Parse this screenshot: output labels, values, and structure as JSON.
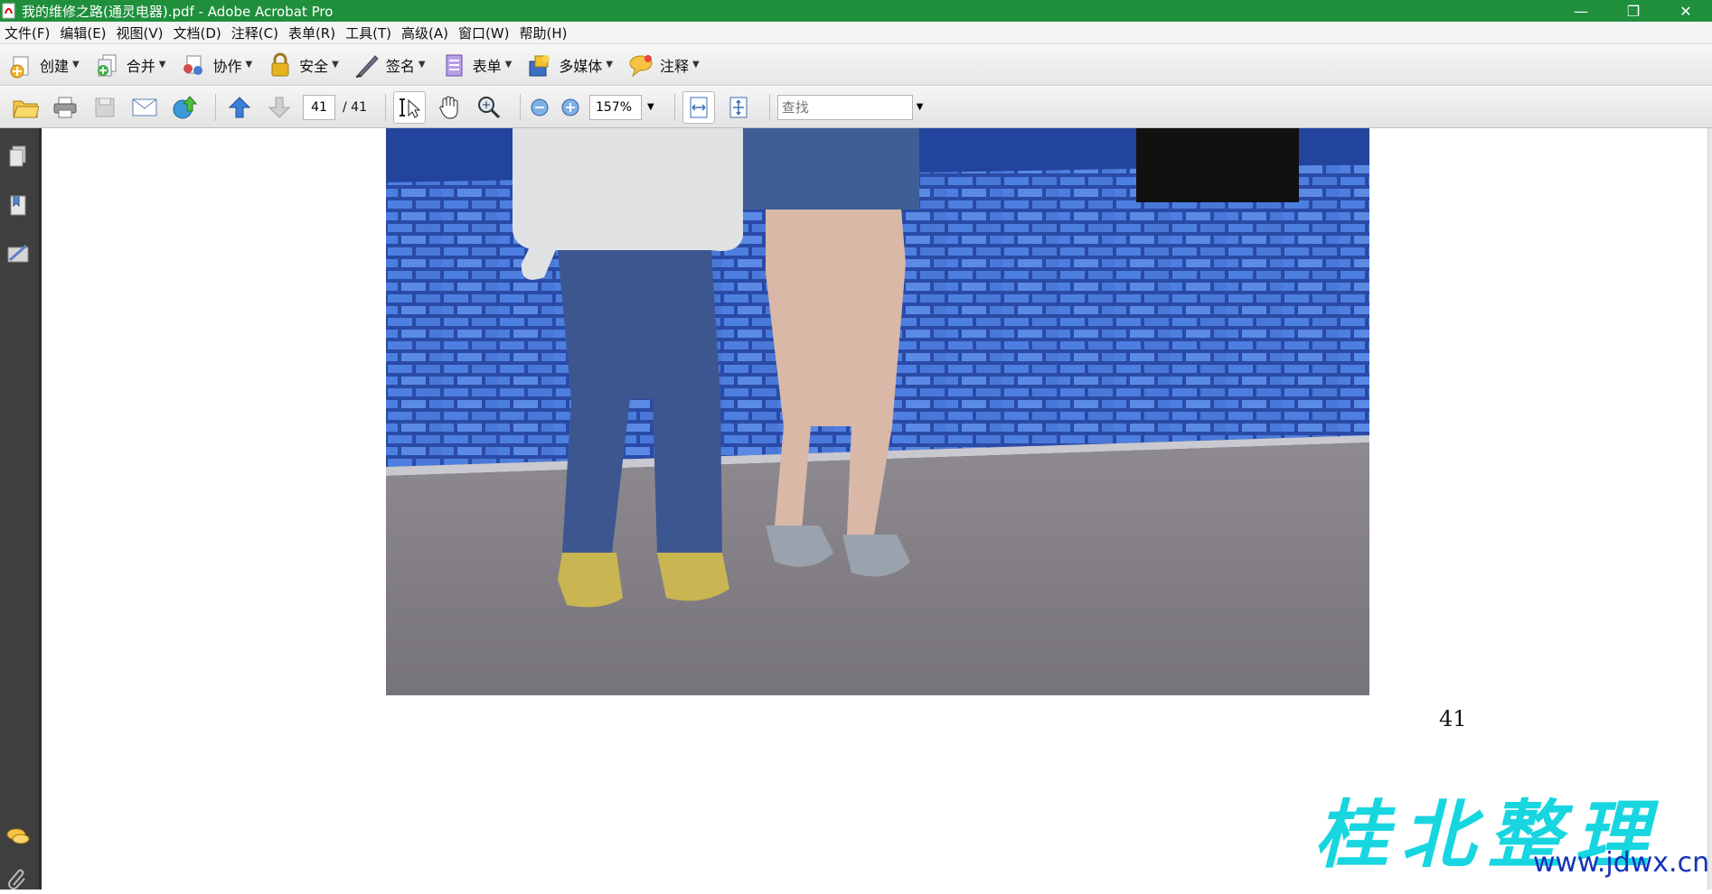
{
  "window": {
    "title": "我的维修之路(通灵电器).pdf - Adobe Acrobat Pro",
    "controls": [
      "—",
      "❐",
      "✕"
    ]
  },
  "menu": [
    "文件(F)",
    "编辑(E)",
    "视图(V)",
    "文档(D)",
    "注释(C)",
    "表单(R)",
    "工具(T)",
    "高级(A)",
    "窗口(W)",
    "帮助(H)"
  ],
  "toolbar1": [
    {
      "label": "创建",
      "icon": "create-icon"
    },
    {
      "label": "合并",
      "icon": "combine-icon"
    },
    {
      "label": "协作",
      "icon": "collaborate-icon"
    },
    {
      "label": "安全",
      "icon": "lock-icon"
    },
    {
      "label": "签名",
      "icon": "pen-icon"
    },
    {
      "label": "表单",
      "icon": "form-icon"
    },
    {
      "label": "多媒体",
      "icon": "multimedia-icon"
    },
    {
      "label": "注释",
      "icon": "comment-icon"
    }
  ],
  "toolbar2": {
    "page_current": "41",
    "page_total": "/ 41",
    "zoom": "157%",
    "find_placeholder": "查找"
  },
  "document": {
    "page_number": "41"
  },
  "watermark": {
    "chinese": "桂北整理",
    "url": "www.jdwx.cn"
  },
  "colors": {
    "titlebar": "#1f8f3c",
    "nav_panel": "#3f3f3f",
    "watermark_cyan": "#18d6e0",
    "watermark_blue": "#1632b8"
  }
}
